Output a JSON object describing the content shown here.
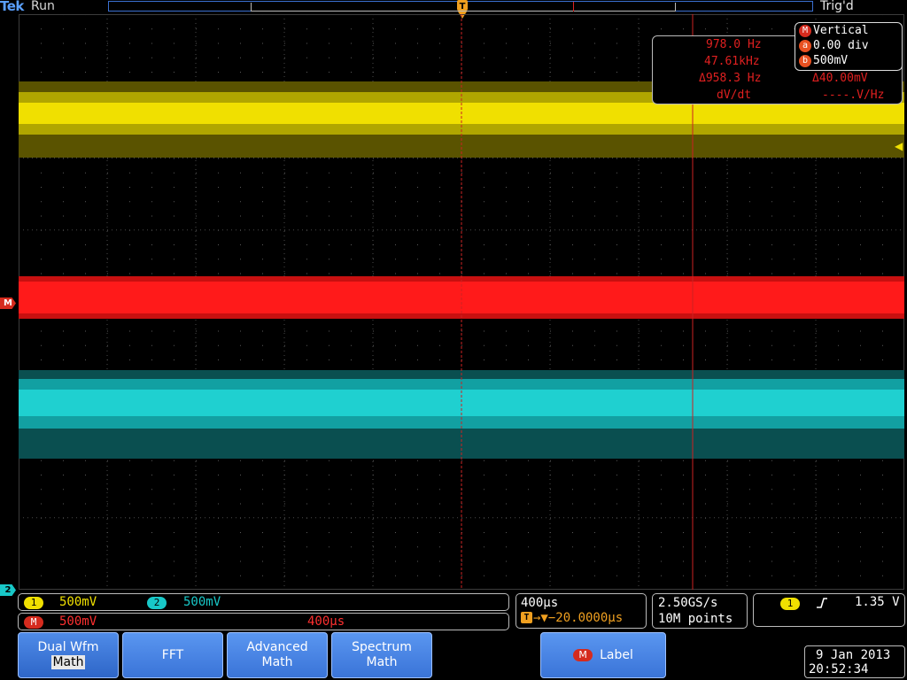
{
  "header": {
    "brand": "Tek",
    "run_state": "Run",
    "trigger_state": "Trig'd",
    "trigger_marker": "T"
  },
  "measurements": {
    "row1_left": "978.0 Hz",
    "row2_left": "47.61kHz",
    "row3_left": "Δ958.3 Hz",
    "row3_right": "Δ40.00mV",
    "row4_left": "dV/dt",
    "row4_right": "----.V/Hz"
  },
  "vertical_panel": {
    "badge": "M",
    "title": "Vertical",
    "a_badge": "a",
    "a_value": "0.00 div",
    "b_badge": "b",
    "b_value": "500mV"
  },
  "channels": {
    "ch1": {
      "badge": "1",
      "scale": "500mV",
      "color": "#f0e000"
    },
    "ch2": {
      "badge": "2",
      "scale": "500mV",
      "color": "#18c8c8"
    },
    "math": {
      "badge": "M",
      "scale": "500mV",
      "timebase": "400µs",
      "color": "#ff1a1a"
    }
  },
  "markers": {
    "math_left": "M",
    "ch2_left": "2"
  },
  "horizontal": {
    "timebase": "400µs",
    "trigger_prefix": "T",
    "position": "→▼−20.0000µs"
  },
  "acquisition": {
    "sample_rate": "2.50GS/s",
    "record_length": "10M points"
  },
  "trigger": {
    "source_badge": "1",
    "slope_icon": "rising-edge",
    "level": "1.35 V"
  },
  "menu": {
    "dual_wfm_line1": "Dual Wfm",
    "dual_wfm_line2": "Math",
    "fft": "FFT",
    "advanced_line1": "Advanced",
    "advanced_line2": "Math",
    "spectrum_line1": "Spectrum",
    "spectrum_line2": "Math",
    "label_badge": "M",
    "label": "Label"
  },
  "datetime": {
    "date": "9 Jan  2013",
    "time": "20:52:34"
  }
}
